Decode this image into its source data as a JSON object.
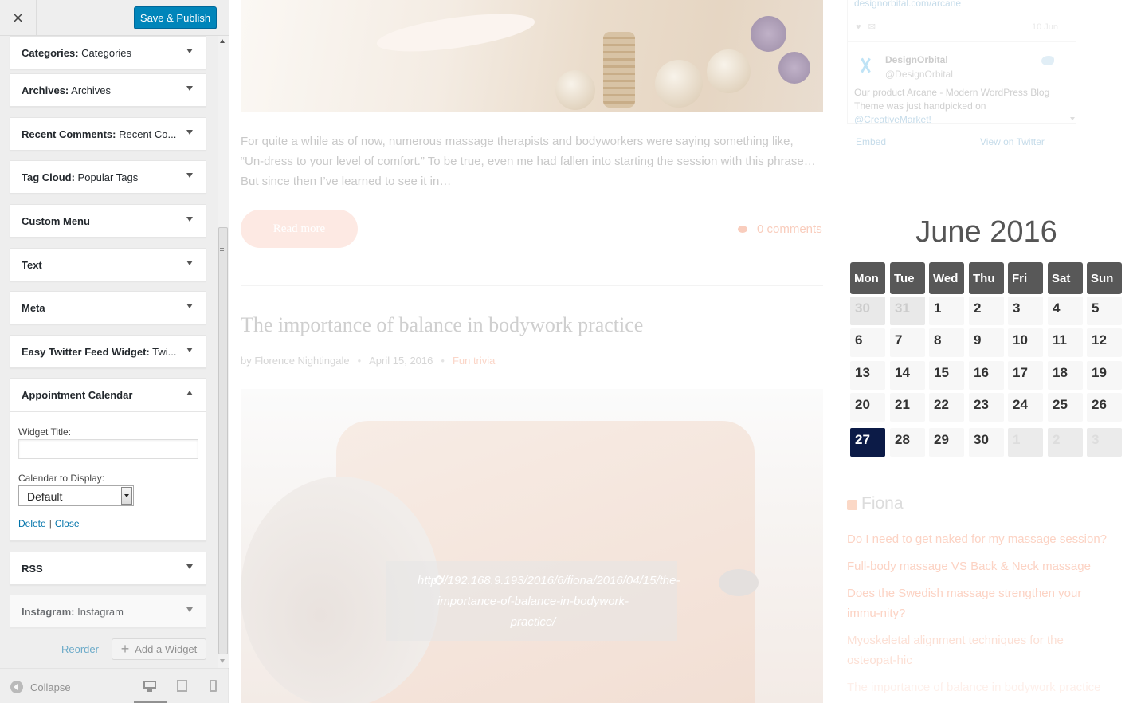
{
  "sidebar": {
    "close_label": "×",
    "publish_label": "Save & Publish",
    "widgets": [
      {
        "name": "Categories:",
        "title": "Categories"
      },
      {
        "name": "Archives:",
        "title": "Archives"
      },
      {
        "name": "Recent Comments:",
        "title": "Recent Co..."
      },
      {
        "name": "Tag Cloud:",
        "title": "Popular Tags"
      },
      {
        "name": "Custom Menu",
        "title": ""
      },
      {
        "name": "Text",
        "title": ""
      },
      {
        "name": "Meta",
        "title": ""
      },
      {
        "name": "Easy Twitter Feed Widget:",
        "title": "Twi..."
      }
    ],
    "open_widget": {
      "name": "Appointment Calendar",
      "title_label": "Widget Title:",
      "title_value": "",
      "calendar_label": "Calendar to Display:",
      "calendar_value": "Default",
      "delete_label": "Delete",
      "sep": "|",
      "close_label": "Close"
    },
    "widgets_after": [
      {
        "name": "RSS",
        "title": ""
      },
      {
        "name": "Instagram:",
        "title": "Instagram"
      }
    ],
    "reorder_label": "Reorder",
    "add_widget_label": "Add a Widget",
    "add_widget_icon": "+",
    "collapse_label": "Collapse"
  },
  "preview": {
    "excerpt": "For quite a while as of now, numerous massage therapists and bodyworkers were saying something like, “Un-dress to your level of comfort.” To be true, even me had fallen into starting the session with this phrase… But since then I’ve learned to see it in…",
    "read_more": "Read more",
    "comments": "0 comments",
    "post_title": "The importance of balance in bodywork practice",
    "post_meta": {
      "author": "by Florence Nightingale",
      "date": "April 15, 2016",
      "category": "Fun trivia"
    },
    "post_url": "http://192.168.9.193/2016/6/fiona/2016/04/15/the-importance-of-balance-in-bodywork-practice/",
    "twitter": {
      "top_url": "designorbital.com/arcane",
      "time": "10 Jun",
      "account_name": "DesignOrbital",
      "account_handle": "@DesignOrbital",
      "tweet_text": "Our product Arcane - Modern WordPress Blog Theme was just handpicked on",
      "tweet_mention": "@CreativeMarket!",
      "embed_label": "Embed",
      "view_label": "View on Twitter"
    },
    "calendar": {
      "title": "June 2016",
      "weekdays": [
        "Mon",
        "Tue",
        "Wed",
        "Thu",
        "Fri",
        "Sat",
        "Sun"
      ],
      "weeks": [
        [
          "30",
          "31",
          "1",
          "2",
          "3",
          "4",
          "5"
        ],
        [
          "6",
          "7",
          "8",
          "9",
          "10",
          "11",
          "12"
        ],
        [
          "13",
          "14",
          "15",
          "16",
          "17",
          "18",
          "19"
        ],
        [
          "20",
          "21",
          "22",
          "23",
          "24",
          "25",
          "26"
        ],
        [
          "27",
          "28",
          "29",
          "30",
          "1",
          "2",
          "3"
        ]
      ],
      "today": "27"
    },
    "rss": {
      "title": "Fiona",
      "items": [
        "Do I need to get naked for my massage session?",
        "Full-body massage VS Back & Neck massage",
        "Does the Swedish massage strengthen your immu-nity?",
        "Myoskeletal alignment techniques for the osteopat-hic",
        "The importance of balance in bodywork practice"
      ]
    }
  }
}
